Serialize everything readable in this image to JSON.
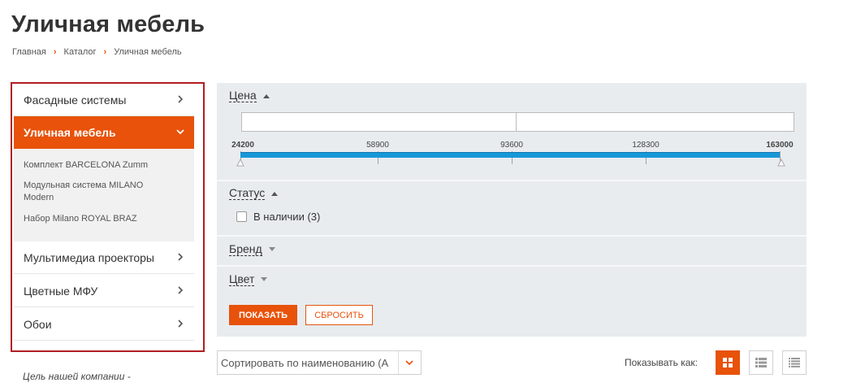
{
  "page_title": "Уличная мебель",
  "breadcrumb": [
    "Главная",
    "Каталог",
    "Уличная мебель"
  ],
  "sidebar": {
    "items": [
      {
        "label": "Фасадные системы"
      },
      {
        "label": "Уличная мебель"
      },
      {
        "label": "Мультимедиа проекторы"
      },
      {
        "label": "Цветные МФУ"
      },
      {
        "label": "Обои"
      }
    ],
    "subitems": [
      {
        "label": "Комплект BARCELONA Zumm"
      },
      {
        "label": "Модульная система MILANO Modern"
      },
      {
        "label": "Набор Milano ROYAL BRAZ"
      }
    ]
  },
  "mission_text": "Цель нашей компании -",
  "filter": {
    "price": {
      "label": "Цена",
      "min_value": "",
      "max_value": "",
      "ticks": [
        "24200",
        "58900",
        "93600",
        "128300",
        "163000"
      ]
    },
    "status": {
      "label": "Статус",
      "option": "В наличии (3)"
    },
    "brand": {
      "label": "Бренд"
    },
    "color": {
      "label": "Цвет"
    },
    "show_button": "ПОКАЗАТЬ",
    "reset_button": "СБРОСИТЬ"
  },
  "sort": {
    "value": "Сортировать по наименованию (А"
  },
  "view": {
    "label": "Показывать как:"
  },
  "colors": {
    "accent": "#e8520a",
    "frame": "#b01e23",
    "slider": "#1897d8",
    "filter_bg": "#e8ecef"
  }
}
